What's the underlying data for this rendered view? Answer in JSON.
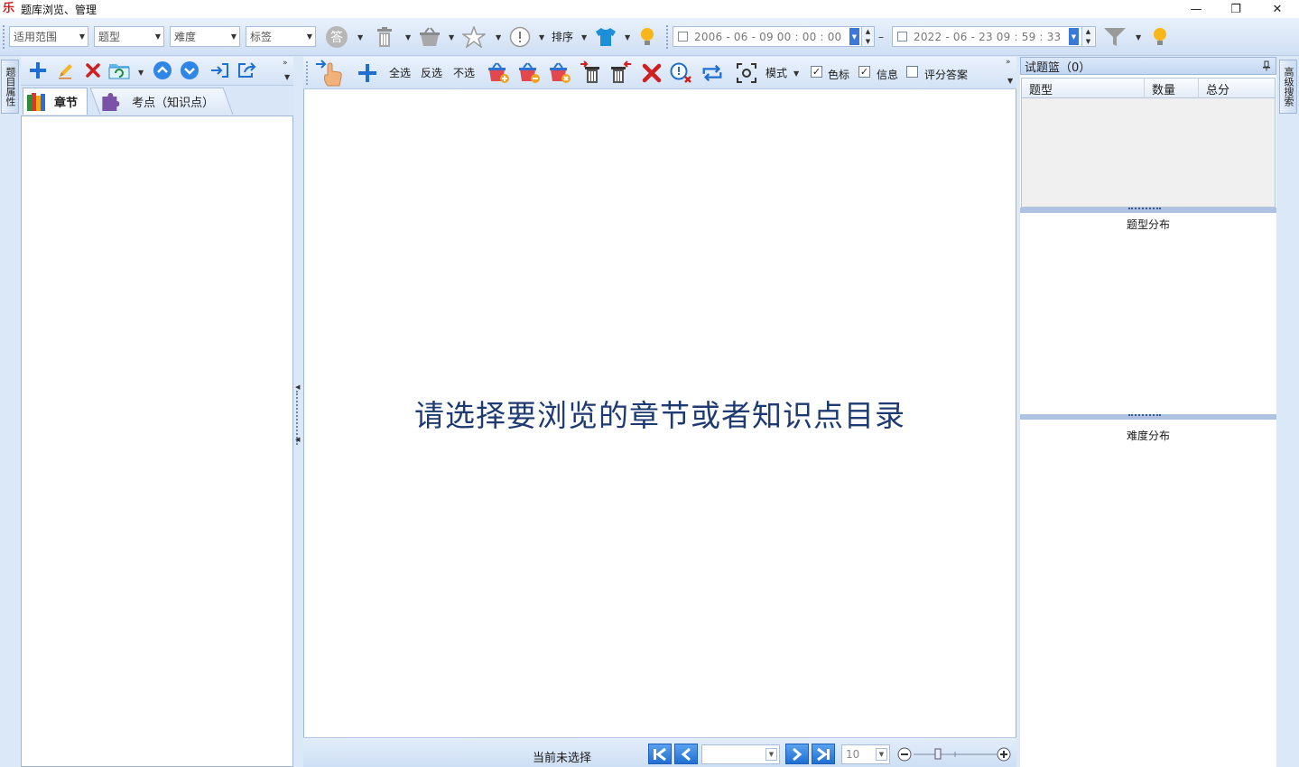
{
  "window": {
    "title": "题库浏览、管理",
    "logo_char": "乐",
    "min_glyph": "—",
    "restore_glyph": "❐",
    "close_glyph": "✕"
  },
  "filters": {
    "scope": "适用范围",
    "type": "题型",
    "difficulty": "难度",
    "tags": "标签"
  },
  "toolbar": {
    "sort_label": "排序"
  },
  "date_range": {
    "start": "2006 - 06 - 09    00 : 00 : 00",
    "end": "2022 - 06 - 23    09 : 59 : 33",
    "separator": "–"
  },
  "left_strip": {
    "label": "题目属性"
  },
  "right_strip": {
    "label": "高级搜索"
  },
  "left_tabs": [
    {
      "label": "章节"
    },
    {
      "label": "考点（知识点）"
    }
  ],
  "center_toolbar": {
    "select_all": "全选",
    "invert_select": "反选",
    "deselect": "不选",
    "mode_label": "模式",
    "color_mark": "色标",
    "color_mark_checked": true,
    "info": "信息",
    "info_checked": true,
    "score_answer": "评分答案",
    "score_answer_checked": false
  },
  "center": {
    "placeholder": "请选择要浏览的章节或者知识点目录"
  },
  "status": {
    "selection": "当前未选择",
    "page_size": "10"
  },
  "basket": {
    "title": "试题篮（0）",
    "columns": [
      "题型",
      "数量",
      "总分"
    ],
    "type_dist": "题型分布",
    "difficulty_dist": "难度分布"
  },
  "colors": {
    "accent_blue": "#1f6fd3",
    "delete_red": "#d11f1f",
    "background": "#dbe8f8"
  }
}
